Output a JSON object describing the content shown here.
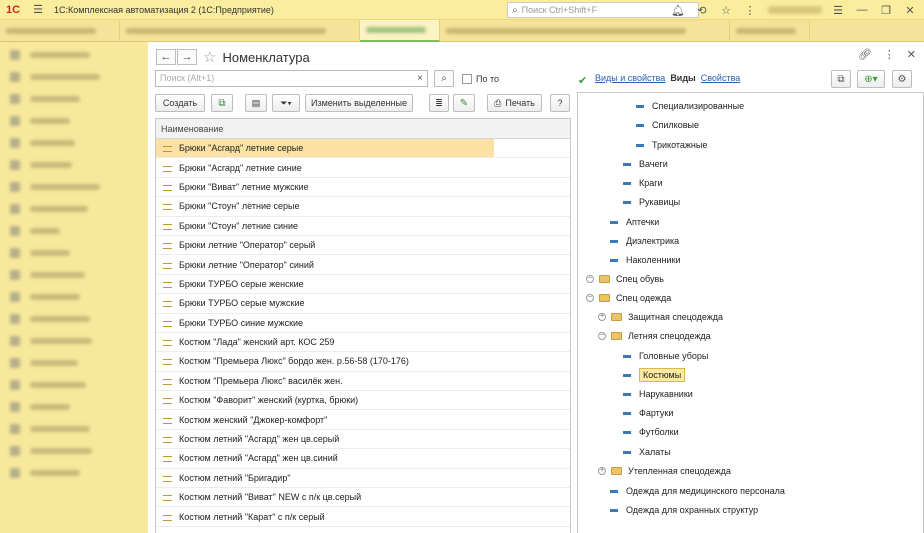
{
  "app": {
    "title": "1С:Комплексная автоматизация 2  (1С:Предприятие)",
    "search_placeholder": "Поиск Ctrl+Shift+F"
  },
  "window": {
    "title": "Номенклатура",
    "search_placeholder": "Поиск (Alt+1)",
    "filter_checkbox_label": "По то",
    "toolbar": {
      "create": "Создать",
      "edit_selected": "Изменить выделенные",
      "print": "Печать",
      "help": "?"
    },
    "list_header": "Наименование",
    "items": [
      "Брюки \"Асгард\" летние серые",
      "Брюки \"Асгард\" летние синие",
      "Брюки \"Виват\" летние мужские",
      "Брюки \"Стоун\" летние серые",
      "Брюки \"Стоун\" летние синие",
      "Брюки летние \"Оператор\" серый",
      "Брюки летние \"Оператор\" синий",
      "Брюки ТУРБО серые женские",
      "Брюки ТУРБО серые мужские",
      "Брюки ТУРБО синие мужские",
      "Костюм \"Лада\" женский арт. КОС 259",
      "Костюм \"Премьера Люкс\"  бордо жен. р.56-58 (170-176)",
      "Костюм \"Премьера Люкс\" василёк жен.",
      "Костюм \"Фаворит\" женский (куртка, брюки)",
      "Костюм женский \"Джокер-комфорт\"",
      "Костюм летний \"Асгард\" жен цв.серый",
      "Костюм летний \"Асгард\" жен цв.синий",
      "Костюм летний \"Бригадир\"",
      "Костюм летний \"Виват\" NEW с п/к  цв.серый",
      "Костюм летний \"Карат\" с п/к серый"
    ],
    "right_panel": {
      "link_kinds_props": "Виды и свойства",
      "tab_kinds": "Виды",
      "link_props": "Свойства",
      "tree": [
        "Специализированные",
        "Спилковые",
        "Трикотажные",
        "Вачеги",
        "Краги",
        "Рукавицы",
        "Аптечки",
        "Диэлектрика",
        "Наколенники",
        "Спец обувь",
        "Спец одежда",
        "Защитная спецодежда",
        "Летняя спецодежда",
        "Головные уборы",
        "Костюмы",
        "Нарукавники",
        "Фартуки",
        "Футболки",
        "Халаты",
        "Утепленная спецодежда",
        "Одежда для медицинского персонала",
        "Одежда для охранных структур"
      ]
    }
  },
  "colors": {
    "accent": "#fbed9e",
    "selection": "#fbe2a4",
    "link": "#2a5fb0"
  }
}
